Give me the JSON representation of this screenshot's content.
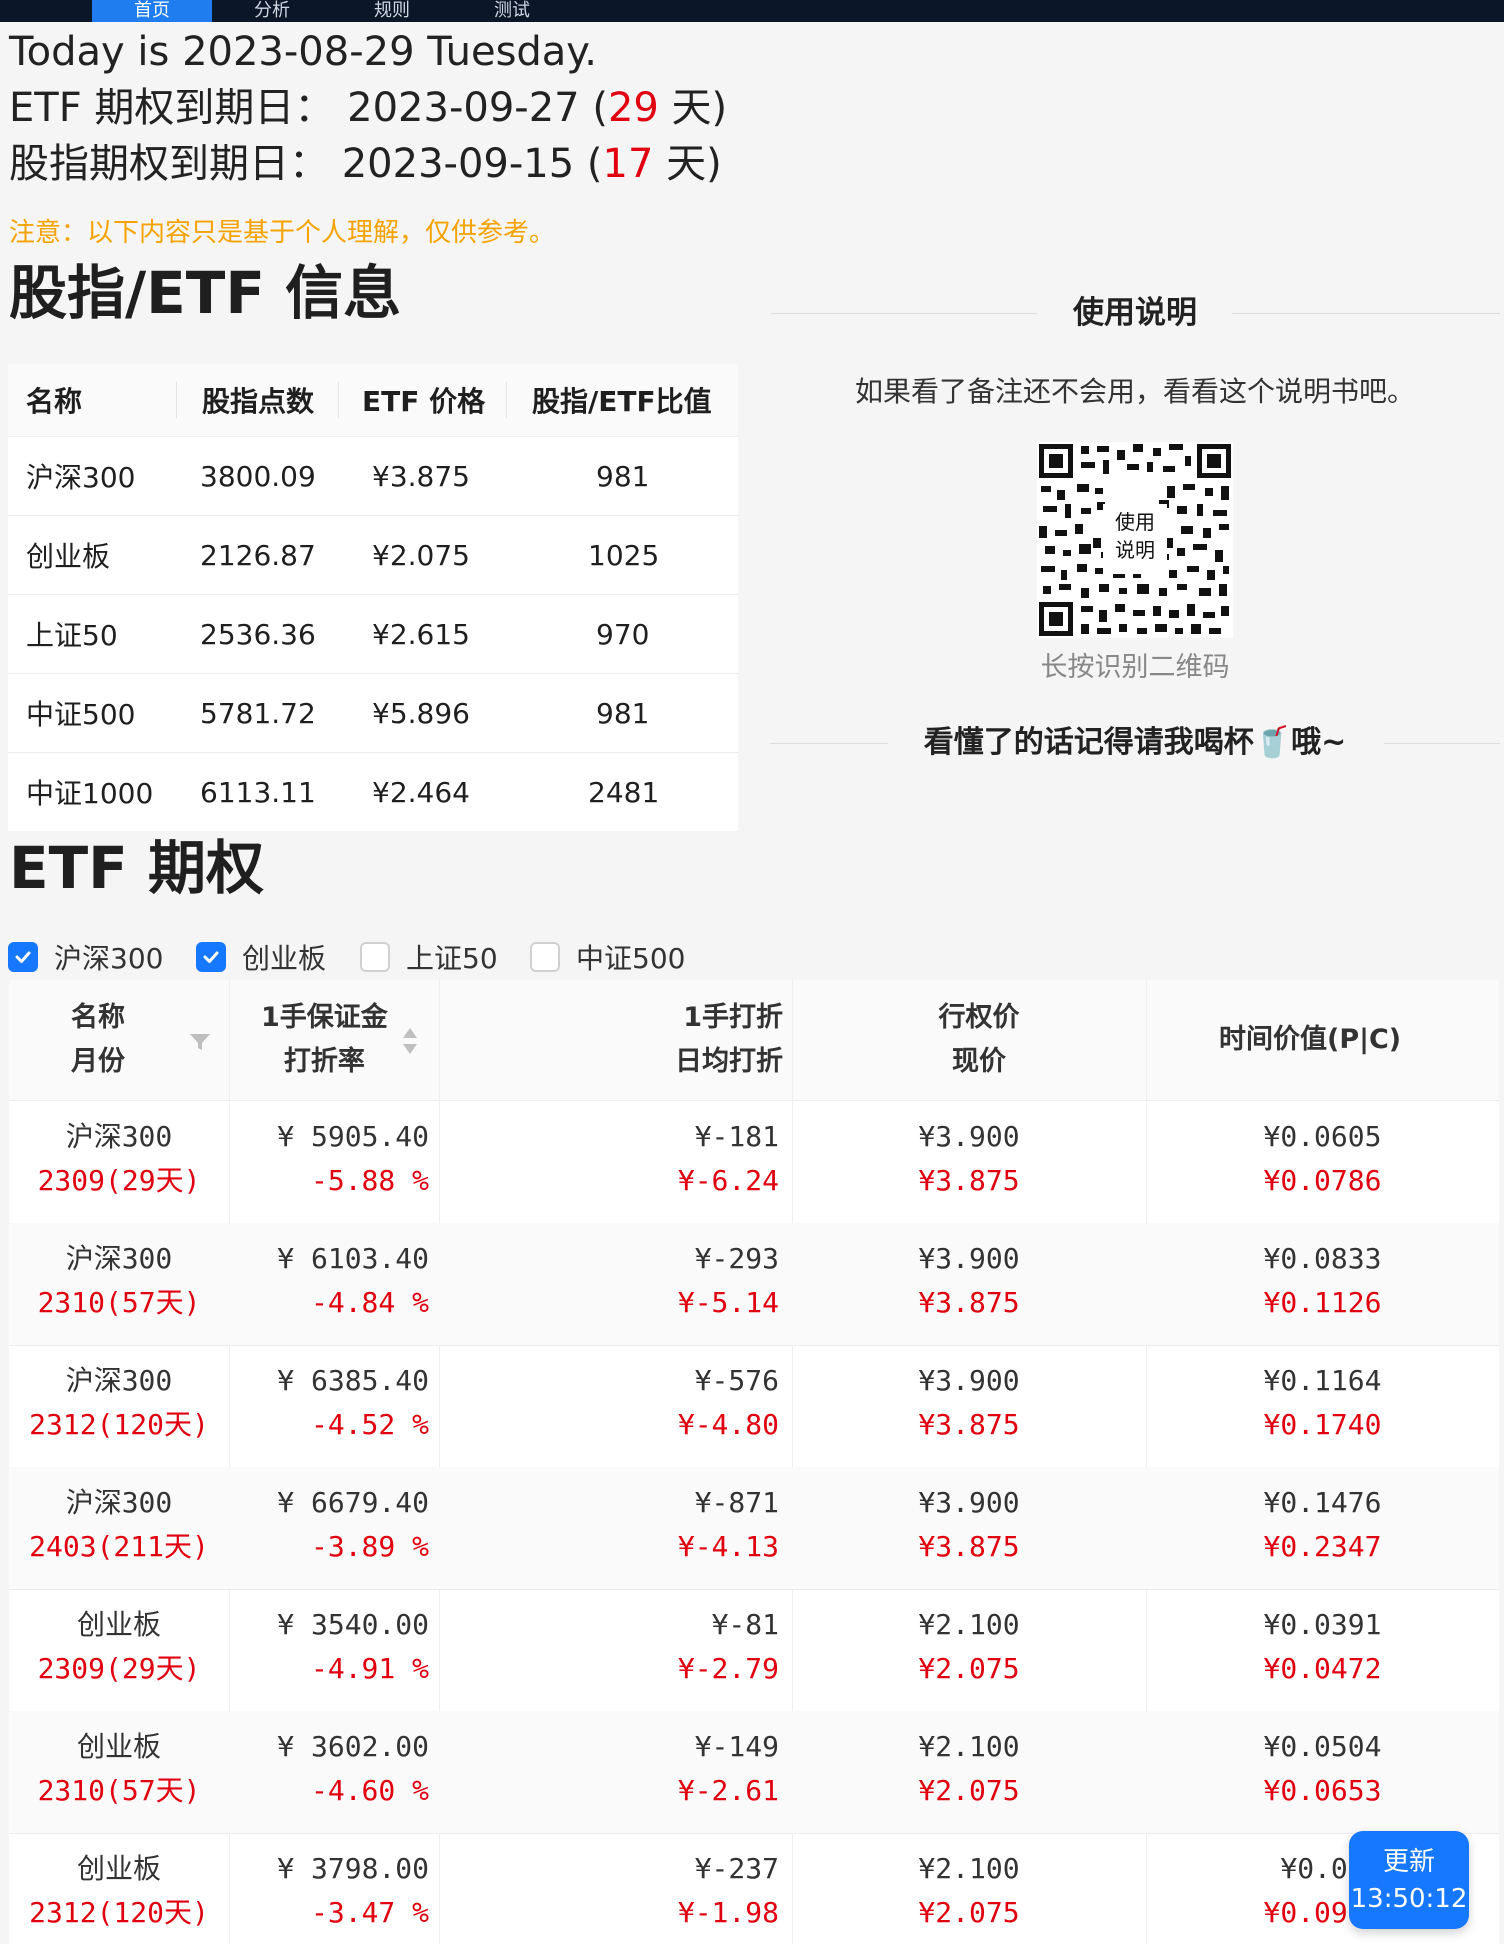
{
  "nav": {
    "tabs": [
      "首页",
      "分析",
      "规则",
      "测试"
    ]
  },
  "header": {
    "today_label": "Today is 2023-08-29 Tuesday.",
    "etf_expiry_label": "ETF 期权到期日：",
    "etf_expiry_date": "2023-09-27 (",
    "etf_expiry_days": "29",
    "etf_expiry_suffix": " 天)",
    "index_expiry_label": "股指期权到期日：",
    "index_expiry_date": "2023-09-15 (",
    "index_expiry_days": "17",
    "index_expiry_suffix": " 天)"
  },
  "notice": "注意：以下内容只是基于个人理解，仅供参考。",
  "index_section": {
    "title": "股指/ETF 信息",
    "columns": [
      "名称",
      "股指点数",
      "ETF 价格",
      "股指/ETF比值"
    ],
    "rows": [
      {
        "name": "沪深300",
        "points": "3800.09",
        "price": "¥3.875",
        "ratio": "981"
      },
      {
        "name": "创业板",
        "points": "2126.87",
        "price": "¥2.075",
        "ratio": "1025"
      },
      {
        "name": "上证50",
        "points": "2536.36",
        "price": "¥2.615",
        "ratio": "970"
      },
      {
        "name": "中证500",
        "points": "5781.72",
        "price": "¥5.896",
        "ratio": "981"
      },
      {
        "name": "中证1000",
        "points": "6113.11",
        "price": "¥2.464",
        "ratio": "2481"
      }
    ]
  },
  "usage": {
    "title": "使用说明",
    "desc": "如果看了备注还不会用，看看这个说明书吧。",
    "qr_label_1": "使用",
    "qr_label_2": "说明",
    "qr_caption": "长按识别二维码",
    "bottom": "看懂了的话记得请我喝杯🥤哦~"
  },
  "etf_section": {
    "title": "ETF 期权",
    "filters": [
      {
        "label": "沪深300",
        "checked": true
      },
      {
        "label": "创业板",
        "checked": true
      },
      {
        "label": "上证50",
        "checked": false
      },
      {
        "label": "中证500",
        "checked": false
      }
    ],
    "columns": {
      "c1a": "名称",
      "c1b": "月份",
      "c2a": "1手保证金",
      "c2b": "打折率",
      "c3a": "1手打折",
      "c3b": "日均打折",
      "c4a": "行权价",
      "c4b": "现价",
      "c5": "时间价值(P|C)"
    },
    "rows": [
      {
        "name": "沪深300",
        "month": "2309(29天)",
        "margin": "¥ 5905.40",
        "rate": "-5.88 %",
        "disc": "¥-181",
        "daily": "¥-6.24",
        "strike": "¥3.900",
        "cur": "¥3.875",
        "tv1": "¥0.0605",
        "tv2": "¥0.0786"
      },
      {
        "name": "沪深300",
        "month": "2310(57天)",
        "margin": "¥ 6103.40",
        "rate": "-4.84 %",
        "disc": "¥-293",
        "daily": "¥-5.14",
        "strike": "¥3.900",
        "cur": "¥3.875",
        "tv1": "¥0.0833",
        "tv2": "¥0.1126"
      },
      {
        "name": "沪深300",
        "month": "2312(120天)",
        "margin": "¥ 6385.40",
        "rate": "-4.52 %",
        "disc": "¥-576",
        "daily": "¥-4.80",
        "strike": "¥3.900",
        "cur": "¥3.875",
        "tv1": "¥0.1164",
        "tv2": "¥0.1740"
      },
      {
        "name": "沪深300",
        "month": "2403(211天)",
        "margin": "¥ 6679.40",
        "rate": "-3.89 %",
        "disc": "¥-871",
        "daily": "¥-4.13",
        "strike": "¥3.900",
        "cur": "¥3.875",
        "tv1": "¥0.1476",
        "tv2": "¥0.2347"
      },
      {
        "name": "创业板",
        "month": "2309(29天)",
        "margin": "¥ 3540.00",
        "rate": "-4.91 %",
        "disc": "¥-81",
        "daily": "¥-2.79",
        "strike": "¥2.100",
        "cur": "¥2.075",
        "tv1": "¥0.0391",
        "tv2": "¥0.0472"
      },
      {
        "name": "创业板",
        "month": "2310(57天)",
        "margin": "¥ 3602.00",
        "rate": "-4.60 %",
        "disc": "¥-149",
        "daily": "¥-2.61",
        "strike": "¥2.100",
        "cur": "¥2.075",
        "tv1": "¥0.0504",
        "tv2": "¥0.0653"
      },
      {
        "name": "创业板",
        "month": "2312(120天)",
        "margin": "¥ 3798.00",
        "rate": "-3.47 %",
        "disc": "¥-237",
        "daily": "¥-1.98",
        "strike": "¥2.100",
        "cur": "¥2.075",
        "tv1": "¥0.07",
        "tv2": "¥0.0992"
      }
    ]
  },
  "fab": {
    "label": "更新",
    "time": "13:50:12"
  },
  "colors": {
    "accent": "#1677ff",
    "negative": "#e0000f",
    "notice": "#f5a300"
  }
}
